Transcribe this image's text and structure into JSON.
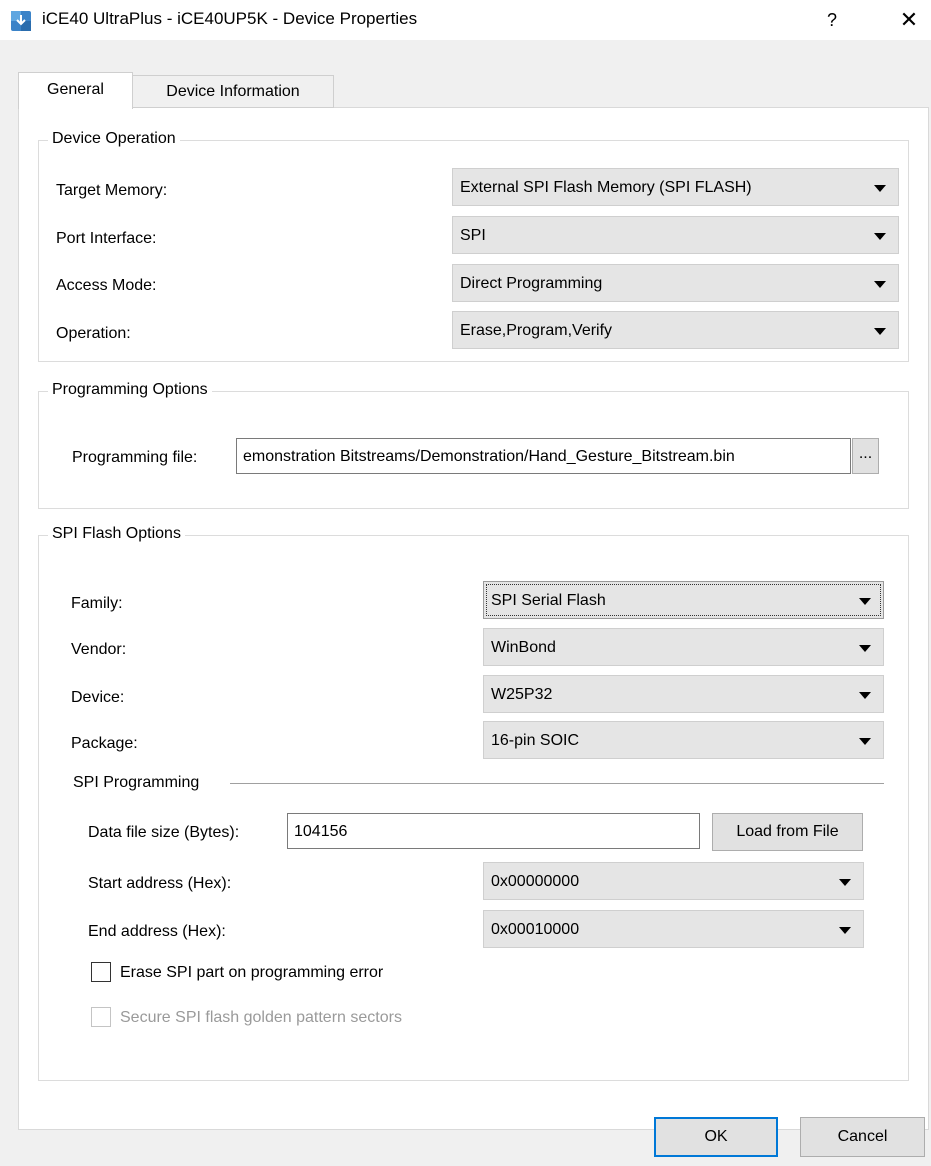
{
  "window": {
    "title": "iCE40 UltraPlus - iCE40UP5K - Device Properties",
    "help_label": "?",
    "close_label": "✕"
  },
  "tabs": [
    {
      "label": "General",
      "selected": true
    },
    {
      "label": "Device Information",
      "selected": false
    }
  ],
  "device_operation": {
    "legend": "Device Operation",
    "target_memory": {
      "label": "Target Memory:",
      "value": "External SPI Flash Memory (SPI FLASH)"
    },
    "port_interface": {
      "label": "Port Interface:",
      "value": "SPI"
    },
    "access_mode": {
      "label": "Access Mode:",
      "value": "Direct Programming"
    },
    "operation": {
      "label": "Operation:",
      "value": "Erase,Program,Verify"
    }
  },
  "programming_options": {
    "legend": "Programming Options",
    "file_label": "Programming file:",
    "file_value": "emonstration Bitstreams/Demonstration/Hand_Gesture_Bitstream.bin",
    "browse_label": "..."
  },
  "spi_flash_options": {
    "legend": "SPI Flash Options",
    "family": {
      "label": "Family:",
      "value": "SPI Serial Flash"
    },
    "vendor": {
      "label": "Vendor:",
      "value": "WinBond"
    },
    "device": {
      "label": "Device:",
      "value": "W25P32"
    },
    "package": {
      "label": "Package:",
      "value": "16-pin SOIC"
    },
    "spi_programming": {
      "heading": "SPI Programming",
      "data_file_size": {
        "label": "Data file size (Bytes):",
        "value": "104156"
      },
      "load_from_file_label": "Load from File",
      "start_address": {
        "label": "Start address (Hex):",
        "value": "0x00000000"
      },
      "end_address": {
        "label": "End address (Hex):",
        "value": "0x00010000"
      },
      "erase_on_error": {
        "label": "Erase SPI part on programming error",
        "checked": false
      },
      "secure_golden": {
        "label": "Secure SPI flash golden pattern sectors",
        "checked": false,
        "enabled": false
      }
    }
  },
  "footer": {
    "ok_label": "OK",
    "cancel_label": "Cancel"
  },
  "colors": {
    "dialog_bg": "#f0f0f0",
    "panel_bg": "#ffffff",
    "dropdown_bg": "#e5e5e5",
    "default_button_border": "#0078d7",
    "disabled_text": "#9a9a9a"
  }
}
